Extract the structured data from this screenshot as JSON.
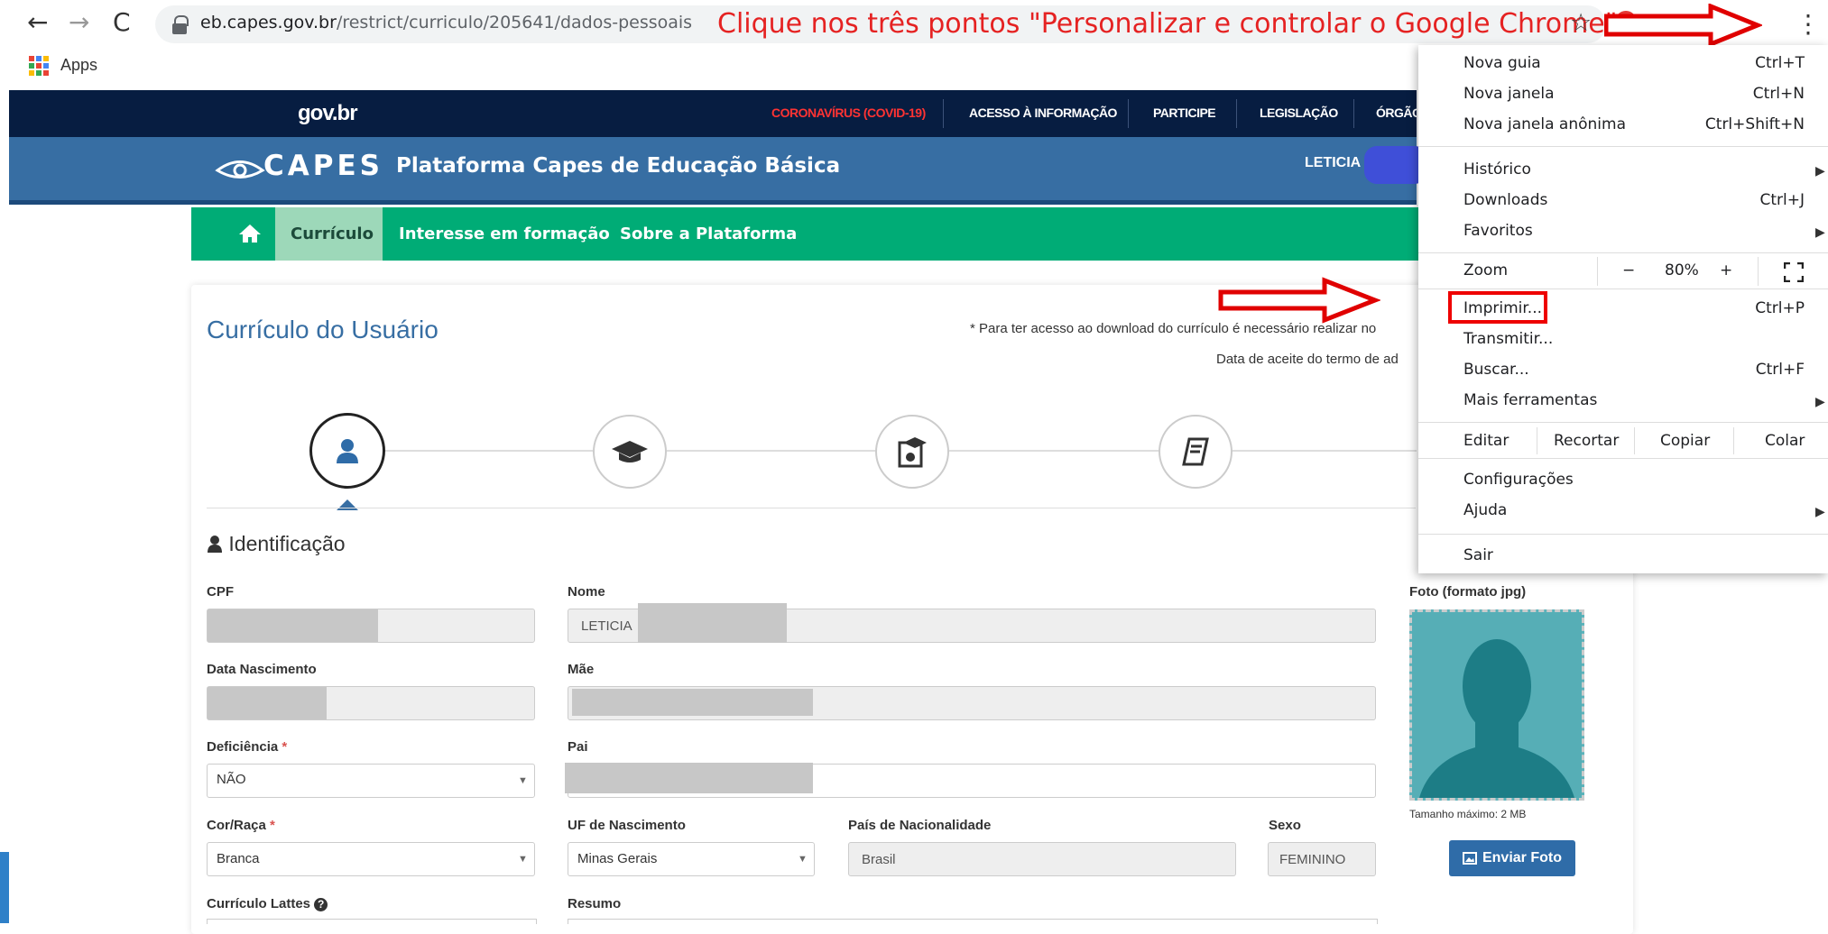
{
  "browser": {
    "url_host": "eb.capes.gov.br",
    "url_path": "/restrict/curriculo/205641/dados-pessoais",
    "instruction": "Clique nos três pontos \"Personalizar e controlar o Google Chrome\"",
    "bookmarks_apps": "Apps",
    "colors": {
      "instruction": "#e52222",
      "arrows": "#e00000"
    }
  },
  "gov": {
    "logo": "gov.br",
    "links": [
      "CORONAVÍRUS (COVID-19)",
      "ACESSO À INFORMAÇÃO",
      "PARTICIPE",
      "LEGISLAÇÃO",
      "ÓRGÃO"
    ],
    "covid_color": "#ff3333"
  },
  "capes": {
    "logo": "CAPES",
    "title": "Plataforma Capes de Educação Básica",
    "user": "LETICIA"
  },
  "nav": {
    "items": [
      "Currículo",
      "Interesse em formação",
      "Sobre a Plataforma"
    ],
    "active": "Currículo"
  },
  "page": {
    "title": "Currículo do Usuário",
    "notice": "* Para ter acesso ao download do currículo é necessário realizar no",
    "accept_date": "Data de aceite do termo de ad",
    "steps": [
      "user-icon",
      "graduation-cap-icon",
      "school-icon",
      "book-icon"
    ],
    "section": "Identificação"
  },
  "form": {
    "cpf_label": "CPF",
    "nome_label": "Nome",
    "nome_value": "LETICIA",
    "nascimento_label": "Data Nascimento",
    "mae_label": "Mãe",
    "deficiencia_label": "Deficiência",
    "deficiencia_value": "NÃO",
    "pai_label": "Pai",
    "cor_label": "Cor/Raça",
    "cor_value": "Branca",
    "uf_label": "UF de Nascimento",
    "uf_value": "Minas Gerais",
    "pais_label": "País de Nacionalidade",
    "pais_value": "Brasil",
    "sexo_label": "Sexo",
    "sexo_value": "FEMININO",
    "lattes_label": "Currículo Lattes",
    "resumo_label": "Resumo",
    "required_mark": "*",
    "photo_label": "Foto (formato jpg)",
    "photo_hint": "Tamanho máximo: 2 MB",
    "send_photo": "Enviar Foto"
  },
  "menu": {
    "nova_guia": "Nova guia",
    "nova_guia_sc": "Ctrl+T",
    "nova_janela": "Nova janela",
    "nova_janela_sc": "Ctrl+N",
    "anonima": "Nova janela anônima",
    "anonima_sc": "Ctrl+Shift+N",
    "historico": "Histórico",
    "downloads": "Downloads",
    "downloads_sc": "Ctrl+J",
    "favoritos": "Favoritos",
    "zoom": "Zoom",
    "zoom_minus": "−",
    "zoom_value": "80%",
    "zoom_plus": "+",
    "imprimir": "Imprimir...",
    "imprimir_sc": "Ctrl+P",
    "transmitir": "Transmitir...",
    "buscar": "Buscar...",
    "buscar_sc": "Ctrl+F",
    "ferramentas": "Mais ferramentas",
    "editar": "Editar",
    "recortar": "Recortar",
    "copiar": "Copiar",
    "colar": "Colar",
    "config": "Configurações",
    "ajuda": "Ajuda",
    "sair": "Sair"
  }
}
